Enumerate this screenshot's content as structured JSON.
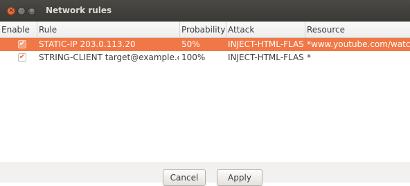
{
  "window": {
    "title": "Network rules",
    "controls": {
      "close_glyph": "✕",
      "minimize_glyph": "–",
      "maximize_glyph": "□"
    }
  },
  "table": {
    "columns": [
      "Enable",
      "Rule",
      "Probability",
      "Attack",
      "Resource"
    ],
    "rows": [
      {
        "enabled": true,
        "rule": "STATIC-IP 203.0.113.20",
        "probability": "50%",
        "attack": "INJECT-HTML-FLASH",
        "resource": "*www.youtube.com/watch*",
        "selected": true
      },
      {
        "enabled": true,
        "rule": "STRING-CLIENT target@example.com",
        "probability": "100%",
        "attack": "INJECT-HTML-FLASH",
        "resource": "*",
        "selected": false
      }
    ],
    "checkmark_glyph": "✔"
  },
  "buttons": {
    "cancel": "Cancel",
    "apply": "Apply"
  },
  "colors": {
    "selection": "#f07746",
    "titlebar": "#3c3b37",
    "close": "#df4a17"
  }
}
